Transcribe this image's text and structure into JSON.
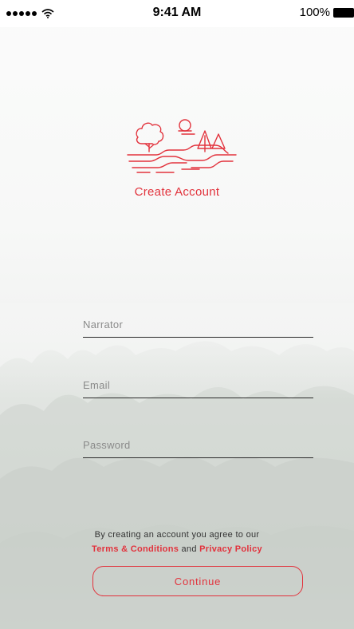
{
  "status_bar": {
    "time": "9:41 AM",
    "battery_percent": "100%",
    "signal_icon": "signal-dots-icon",
    "wifi_icon": "wifi-icon",
    "battery_icon": "battery-icon"
  },
  "header": {
    "logo_icon": "landscape-logo-icon",
    "title": "Create Account"
  },
  "form": {
    "fields": [
      {
        "placeholder": "Narrator",
        "value": ""
      },
      {
        "placeholder": "Email",
        "value": ""
      },
      {
        "placeholder": "Password",
        "value": ""
      }
    ]
  },
  "agreement": {
    "text": "By creating an account you agree to our",
    "terms_link": "Terms & Conditions",
    "conjunction": "and",
    "privacy_link": "Privacy Policy"
  },
  "continue_label": "Continue",
  "colors": {
    "accent": "#e2323c",
    "field_underline": "#2a2a2a",
    "background": "#f4f5f4"
  }
}
